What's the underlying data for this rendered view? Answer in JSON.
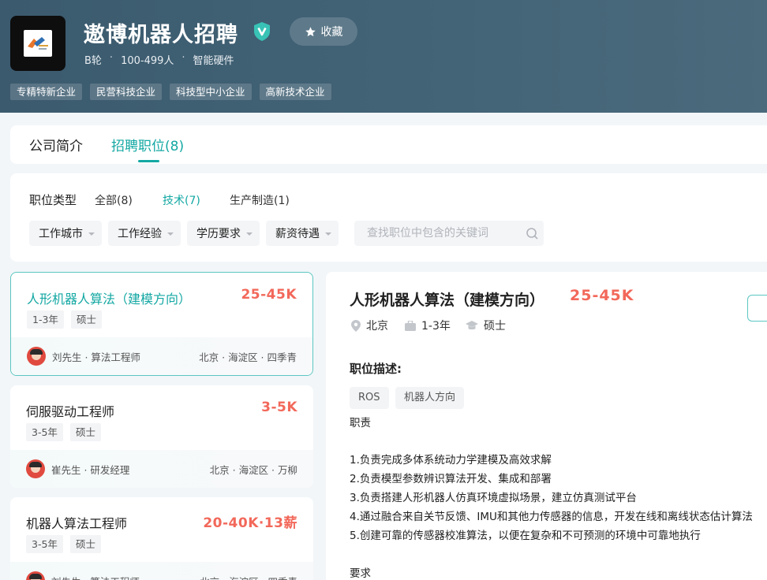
{
  "company": {
    "name": "遨博机器人招聘",
    "favorite_label": "收藏",
    "meta": [
      "B轮",
      "100-499人",
      "智能硬件"
    ],
    "meta_separator": "·",
    "tags": [
      "专精特新企业",
      "民营科技企业",
      "科技型中小企业",
      "高新技术企业"
    ]
  },
  "tabs": [
    {
      "label": "公司简介",
      "active": false
    },
    {
      "label": "招聘职位(8)",
      "active": true
    }
  ],
  "filters": {
    "type_label": "职位类型",
    "types": [
      {
        "label": "全部(8)",
        "active": false
      },
      {
        "label": "技术(7)",
        "active": true
      },
      {
        "label": "生产制造(1)",
        "active": false
      }
    ],
    "dropdowns": [
      "工作城市",
      "工作经验",
      "学历要求",
      "薪资待遇"
    ],
    "search_placeholder": "查找职位中包含的关键词"
  },
  "jobs": [
    {
      "title": "人形机器人算法（建模方向）",
      "salary": "25-45K",
      "tags": [
        "1-3年",
        "硕士"
      ],
      "recruiter": "刘先生 · 算法工程师",
      "location": "北京 · 海淀区 · 四季青",
      "active": true
    },
    {
      "title": "伺服驱动工程师",
      "salary": "3-5K",
      "tags": [
        "3-5年",
        "硕士"
      ],
      "recruiter": "崔先生 · 研发经理",
      "location": "北京 · 海淀区 · 万柳",
      "active": false
    },
    {
      "title": "机器人算法工程师",
      "salary": "20-40K·13薪",
      "tags": [
        "3-5年",
        "硕士"
      ],
      "recruiter": "刘先生 · 算法工程师",
      "location": "北京 · 海淀区 · 四季青",
      "active": false
    }
  ],
  "detail": {
    "title": "人形机器人算法（建模方向）",
    "salary": "25-45K",
    "city": "北京",
    "experience": "1-3年",
    "degree": "硕士",
    "section_title": "职位描述:",
    "keywords": [
      "ROS",
      "机器人方向"
    ],
    "duty_heading": "职责",
    "duties": [
      "1.负责完成多体系统动力学建模及高效求解",
      "2.负责模型参数辨识算法开发、集成和部署",
      "3.负责搭建人形机器人仿真环境虚拟场景，建立仿真测试平台",
      "4.通过融合来自关节反馈、IMU和其他力传感器的信息，开发在线和离线状态估计算法",
      "5.创建可靠的传感器校准算法，以便在复杂和不可预测的环境中可靠地执行"
    ],
    "requirement_heading": "要求"
  },
  "colors": {
    "accent": "#14a8a3",
    "salary": "#f2685a",
    "header_bg": "#3f5f72"
  }
}
